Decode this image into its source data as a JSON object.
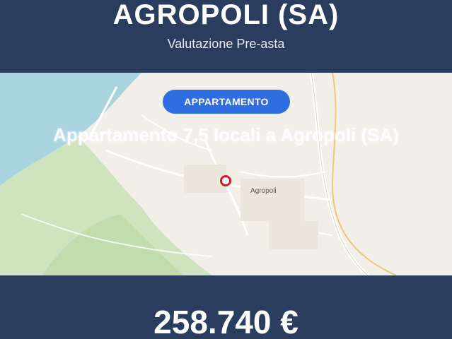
{
  "header": {
    "title": "AGROPOLI (SA)",
    "subtitle": "Valutazione Pre-asta"
  },
  "map": {
    "badge_label": "APPARTAMENTO",
    "property_title": "Appartamento 7,5 locali a Agropoli (SA)",
    "town_label": "Agropoli",
    "colors": {
      "land": "#f2efe8",
      "sea": "#a9d3df",
      "green": "#cfe3bf",
      "pin": "#cc1f1f",
      "badge": "#2f6ee0"
    }
  },
  "footer": {
    "price": "258.740 €"
  },
  "theme": {
    "panel_bg": "#2b3d5e"
  }
}
